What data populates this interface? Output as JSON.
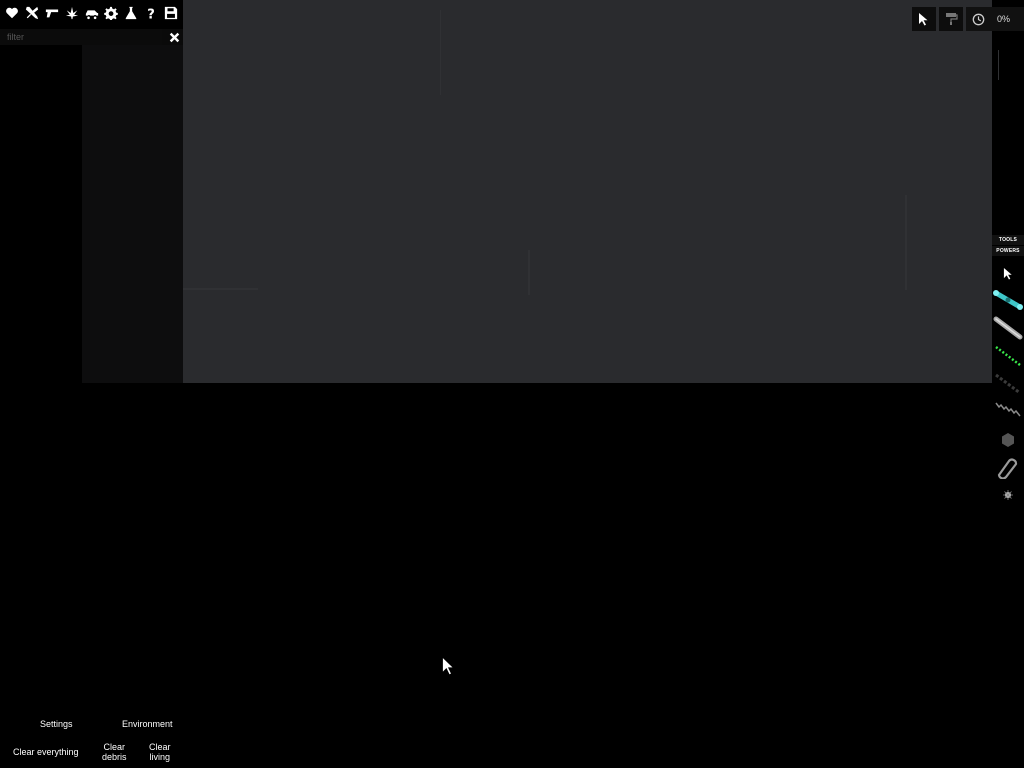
{
  "categories": [
    {
      "icon": "heart-icon"
    },
    {
      "icon": "crossed-swords-icon"
    },
    {
      "icon": "pistol-icon"
    },
    {
      "icon": "cannabis-leaf-icon"
    },
    {
      "icon": "car-icon"
    },
    {
      "icon": "gear-icon"
    },
    {
      "icon": "flask-icon"
    },
    {
      "icon": "question-icon"
    },
    {
      "icon": "save-icon"
    }
  ],
  "filter": {
    "placeholder": "filter",
    "value": ""
  },
  "topbar": {
    "time_percent": "0%"
  },
  "tabs": {
    "tools": "TOOLS",
    "powers": "POWERS"
  },
  "tools": [
    {
      "icon": "pointer-icon"
    },
    {
      "icon": "cyan-cable-icon"
    },
    {
      "icon": "metal-rod-icon"
    },
    {
      "icon": "green-chain-icon"
    },
    {
      "icon": "dark-chain-icon"
    },
    {
      "icon": "grey-spring-icon"
    },
    {
      "icon": "hexagon-icon"
    },
    {
      "icon": "rope-icon"
    },
    {
      "icon": "spark-icon"
    }
  ],
  "bottom": {
    "settings": "Settings",
    "environment": "Environment",
    "clear_everything": "Clear everything",
    "clear_debris_1": "Clear",
    "clear_debris_2": "debris",
    "clear_living_1": "Clear",
    "clear_living_2": "living"
  },
  "colors": {
    "playfield": "#2a2b2e",
    "cyan_cable": "#3ec7c9",
    "green_chain": "#39e64a"
  }
}
